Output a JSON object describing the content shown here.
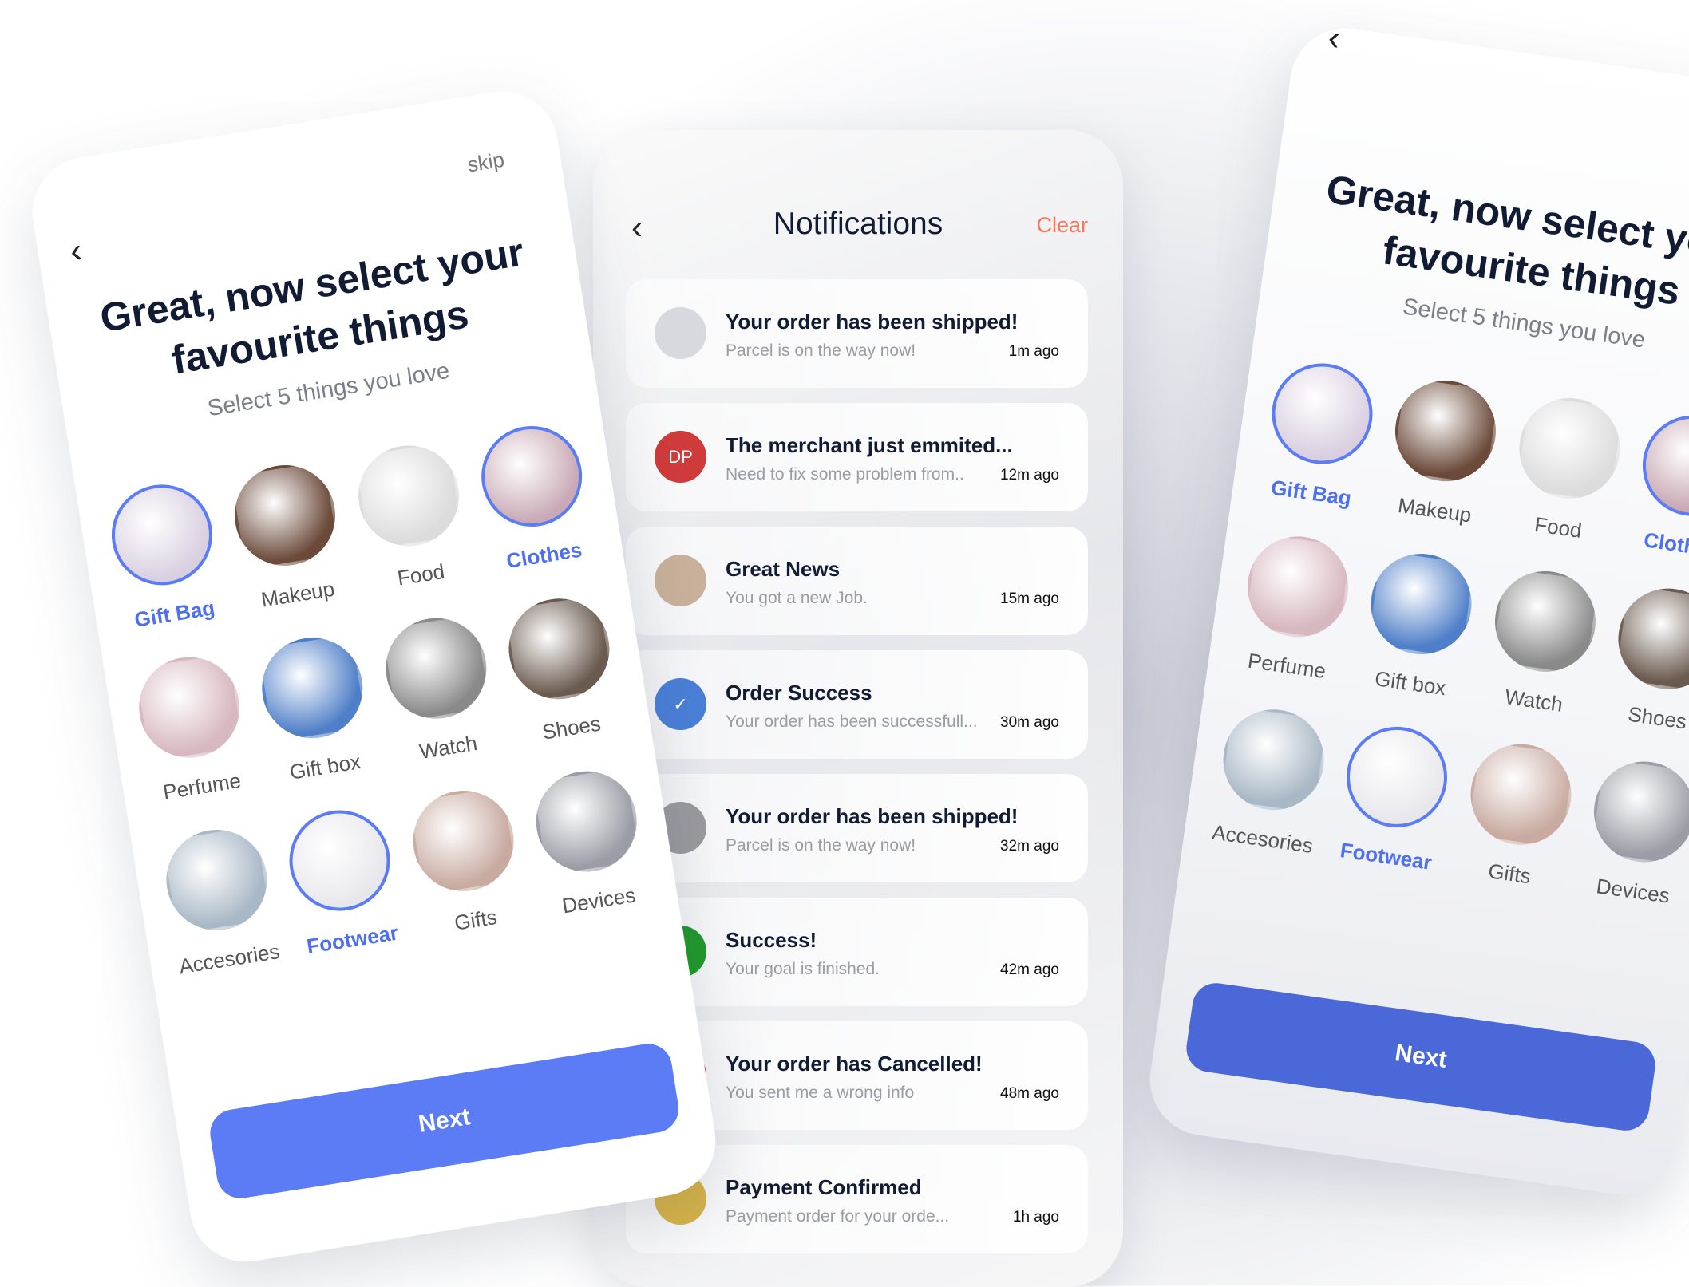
{
  "onboarding": {
    "back_icon": "chevron-left-icon",
    "skip": "skip",
    "title_line1": "Great, now select your",
    "title_line2": "favourite things",
    "subtitle": "Select 5 things you love",
    "next": "Next",
    "accent": "#5b7cf5",
    "categories": [
      {
        "label": "Gift Bag",
        "selected": true,
        "color": "#d9cfe0"
      },
      {
        "label": "Makeup",
        "selected": false,
        "color": "#6b4a3a"
      },
      {
        "label": "Food",
        "selected": false,
        "color": "#dcdcdc"
      },
      {
        "label": "Clothes",
        "selected": true,
        "color": "#c9a9b5"
      },
      {
        "label": "Perfume",
        "selected": false,
        "color": "#d7b7c0"
      },
      {
        "label": "Gift box",
        "selected": false,
        "color": "#4f7fc8"
      },
      {
        "label": "Watch",
        "selected": false,
        "color": "#8a8a8a"
      },
      {
        "label": "Shoes",
        "selected": false,
        "color": "#6a5a4f"
      },
      {
        "label": "Accesories",
        "selected": false,
        "color": "#a9b8c6"
      },
      {
        "label": "Footwear",
        "selected": true,
        "color": "#e8e8ec"
      },
      {
        "label": "Gifts",
        "selected": false,
        "color": "#c8aaa0"
      },
      {
        "label": "Devices",
        "selected": false,
        "color": "#9a9da5"
      }
    ]
  },
  "notifications": {
    "title": "Notifications",
    "clear": "Clear",
    "items": [
      {
        "title": "Your order has been shipped!",
        "subtitle": "Parcel is on the way now!",
        "time": "1m ago",
        "avatar": "image",
        "color": "#d8d9de",
        "initials": ""
      },
      {
        "title": "The merchant just emmited...",
        "subtitle": "Need to fix some problem from..",
        "time": "12m ago",
        "avatar": "initials",
        "color": "#cf3a3a",
        "initials": "DP"
      },
      {
        "title": "Great News",
        "subtitle": "You got a new Job.",
        "time": "15m ago",
        "avatar": "image",
        "color": "#c8b09a",
        "initials": ""
      },
      {
        "title": "Order Success",
        "subtitle": "Your order has been successfull...",
        "time": "30m ago",
        "avatar": "check-icon",
        "color": "#4a7fd8",
        "initials": "✓"
      },
      {
        "title": "Your order has been shipped!",
        "subtitle": "Parcel is on the way now!",
        "time": "32m ago",
        "avatar": "image",
        "color": "#9a9a9e",
        "initials": ""
      },
      {
        "title": "Success!",
        "subtitle": "Your goal is finished.",
        "time": "42m ago",
        "avatar": "check-icon",
        "color": "#1f9a2a",
        "initials": "✓"
      },
      {
        "title": "Your order has Cancelled!",
        "subtitle": "You sent me a wrong info",
        "time": "48m ago",
        "avatar": "icon",
        "color": "#d83838",
        "initials": ""
      },
      {
        "title": "Payment Confirmed",
        "subtitle": "Payment order for your orde...",
        "time": "1h ago",
        "avatar": "card-icon",
        "color": "#d8b547",
        "initials": ""
      }
    ]
  }
}
